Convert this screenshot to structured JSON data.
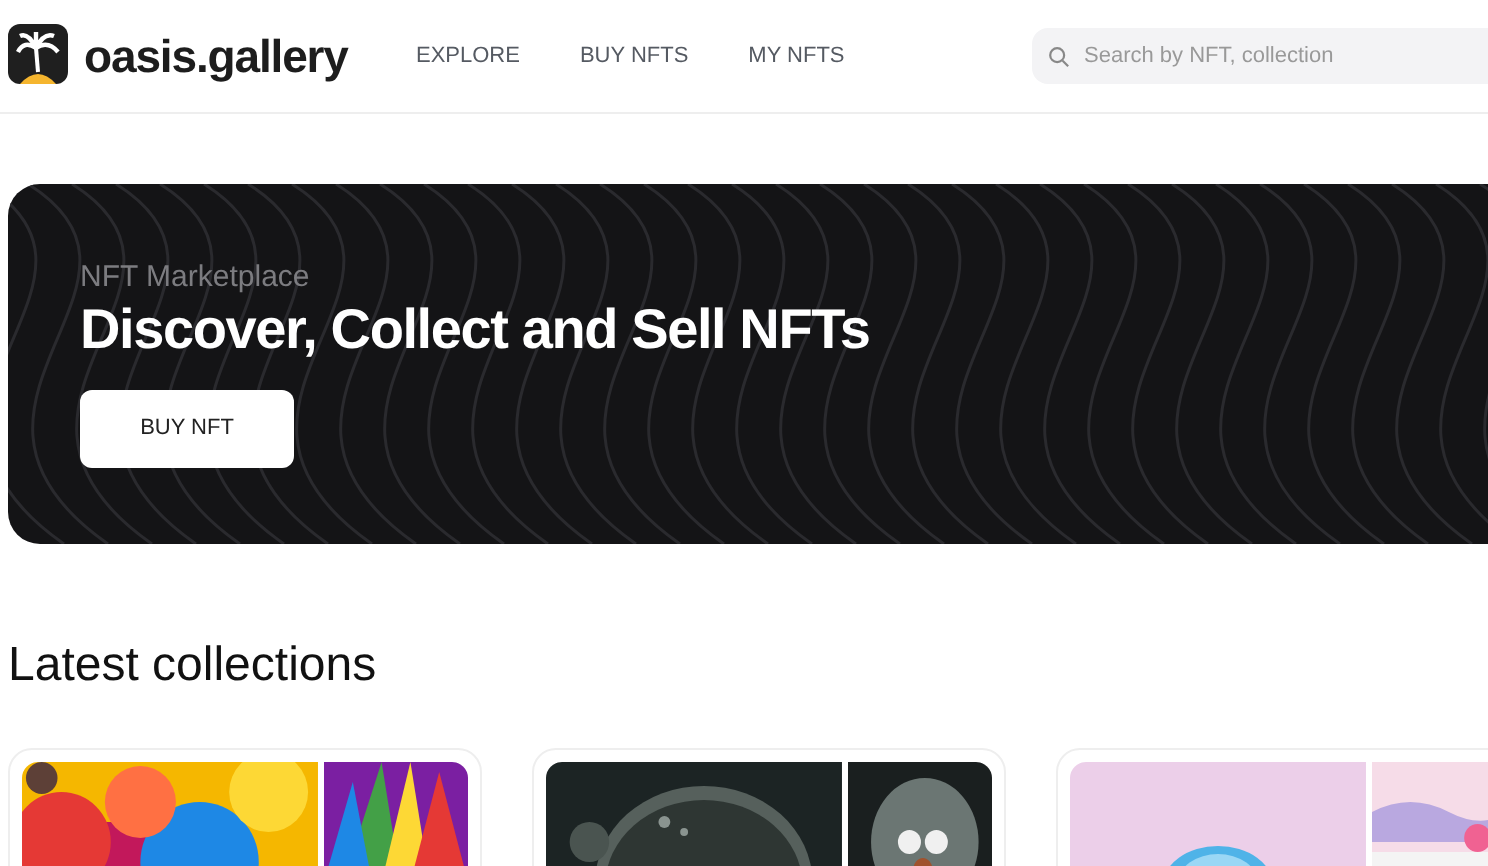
{
  "header": {
    "logo_text": "oasis.gallery",
    "nav": [
      {
        "label": "EXPLORE"
      },
      {
        "label": "BUY NFTS"
      },
      {
        "label": "MY NFTS"
      }
    ],
    "search": {
      "placeholder": "Search by NFT, collection"
    }
  },
  "hero": {
    "subtitle": "NFT Marketplace",
    "title": "Discover, Collect and Sell NFTs",
    "button": "BUY NFT"
  },
  "latest": {
    "title": "Latest collections"
  }
}
